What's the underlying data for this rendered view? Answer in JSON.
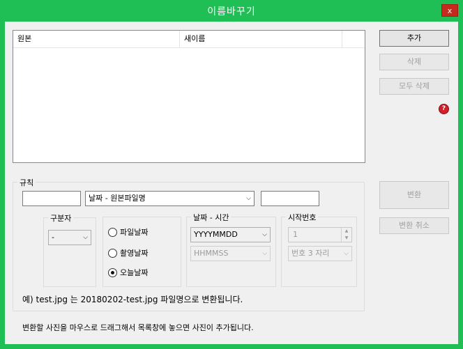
{
  "window": {
    "title": "이름바꾸기",
    "close_label": "x"
  },
  "file_list": {
    "columns": [
      "원본",
      "새이름"
    ]
  },
  "buttons": {
    "add": "추가",
    "delete": "삭제",
    "delete_all": "모두 삭제",
    "convert": "변환",
    "cancel_convert": "변환 취소"
  },
  "rules": {
    "label": "규칙",
    "prefix_value": "",
    "pattern_selected": "날짜 - 원본파일명",
    "suffix_value": "",
    "separator": {
      "label": "구분자",
      "selected": "-"
    },
    "date_source": {
      "options": [
        {
          "label": "파일날짜",
          "checked": false
        },
        {
          "label": "촬영날짜",
          "checked": false
        },
        {
          "label": "오늘날짜",
          "checked": true
        }
      ]
    },
    "datetime": {
      "label": "날짜 - 시간",
      "date_format": "YYYYMMDD",
      "time_format": "HHMMSS"
    },
    "start_number": {
      "label": "시작번호",
      "value": "1",
      "digits": "번호 3 자리"
    },
    "example": "예) test.jpg 는 20180202-test.jpg  파일명으로 변환됩니다."
  },
  "hint": "변환할 사진을 마우스로 드래그해서 목록창에 놓으면 사진이 추가됩니다.",
  "help_icon": "question-icon",
  "colors": {
    "titlebar": "#1fbf55",
    "close": "#c42b1c"
  }
}
